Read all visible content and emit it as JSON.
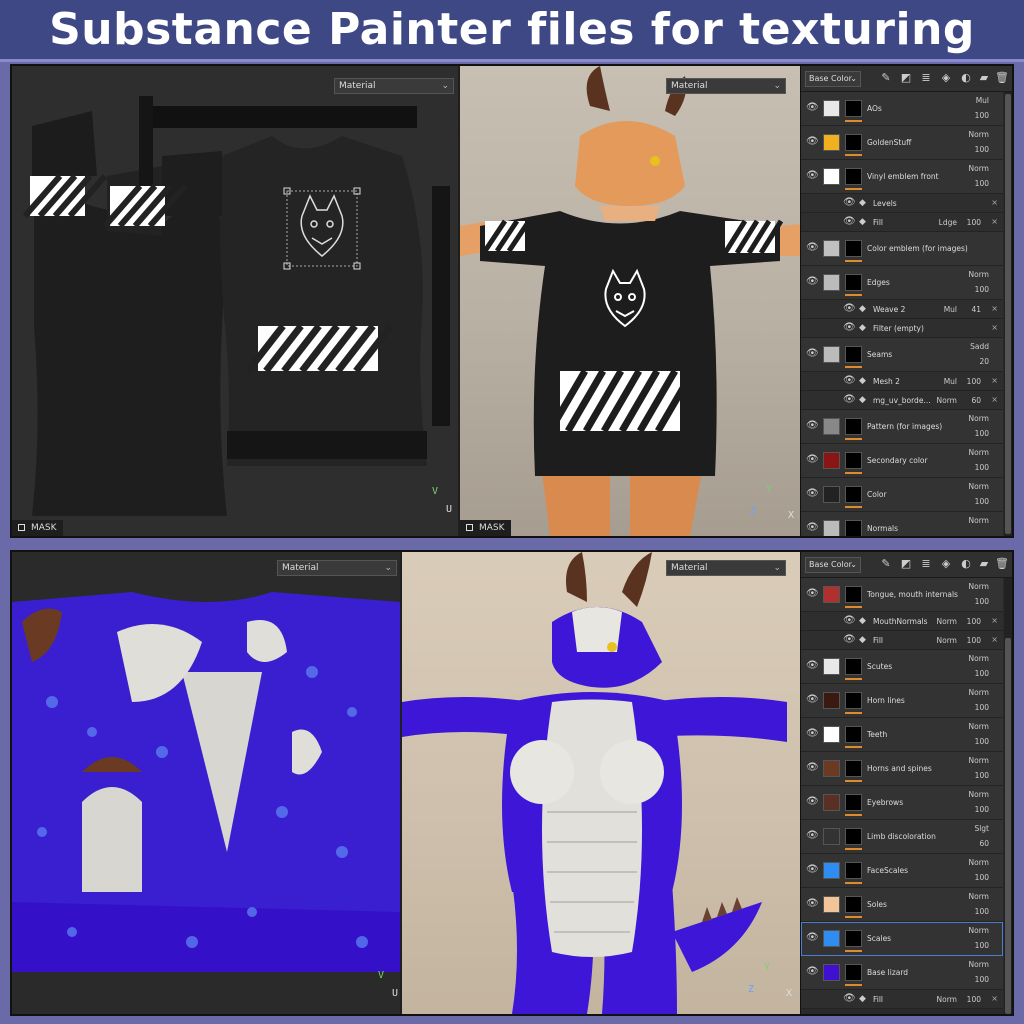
{
  "banner": {
    "title": "Substance Painter files for texturing"
  },
  "top": {
    "uv_dropdown": "Material",
    "view_dropdown": "Material",
    "mask_label": "MASK",
    "mask_label_3d": "MASK",
    "axis": {
      "u": "U",
      "v": "V",
      "x": "X",
      "y": "Y",
      "z": "Z"
    },
    "panel": {
      "channel": "Base Color",
      "layers": [
        {
          "name": "AOs",
          "blend": "Mul",
          "opacity": "100",
          "thumb": "#e8e8e8"
        },
        {
          "name": "GoldenStuff",
          "blend": "Norm",
          "opacity": "100",
          "thumb": "#f0b020"
        },
        {
          "name": "Vinyl emblem front",
          "blend": "Norm",
          "opacity": "100",
          "thumb": "#ffffff"
        },
        {
          "name": "Levels",
          "sub": true
        },
        {
          "name": "Fill",
          "sub": true,
          "blend": "Ldge",
          "opacity": "100"
        },
        {
          "name": "Color emblem (for images)",
          "blend": "",
          "opacity": "",
          "thumb": "#c0c0c0"
        },
        {
          "name": "Edges",
          "blend": "Norm",
          "opacity": "100",
          "thumb": "#bbbbbb"
        },
        {
          "name": "Weave 2",
          "sub": true,
          "blend": "Mul",
          "opacity": "41"
        },
        {
          "name": "Filter (empty)",
          "sub": true
        },
        {
          "name": "Seams",
          "blend": "Sadd",
          "opacity": "20",
          "thumb": "#bbbbbb"
        },
        {
          "name": "Mesh 2",
          "sub": true,
          "blend": "Mul",
          "opacity": "100"
        },
        {
          "name": "mg_uv_borde...",
          "sub": true,
          "blend": "Norm",
          "opacity": "60"
        },
        {
          "name": "Pattern (for images)",
          "blend": "Norm",
          "opacity": "100",
          "thumb": "#888888"
        },
        {
          "name": "Secondary color",
          "blend": "Norm",
          "opacity": "100",
          "thumb": "#8a1515"
        },
        {
          "name": "Color",
          "blend": "Norm",
          "opacity": "100",
          "thumb": "#222222"
        },
        {
          "name": "Normals",
          "blend": "Norm",
          "opacity": "",
          "thumb": "#bbbbbb"
        }
      ]
    }
  },
  "bottom": {
    "uv_dropdown": "Material",
    "view_dropdown": "Material",
    "axis": {
      "u": "U",
      "v": "V",
      "x": "X",
      "y": "Y",
      "z": "Z"
    },
    "panel": {
      "channel": "Base Color",
      "layers": [
        {
          "name": "Tongue, mouth internals",
          "blend": "Norm",
          "opacity": "100",
          "thumb": "#b03030"
        },
        {
          "name": "MouthNormals",
          "sub": true,
          "blend": "Norm",
          "opacity": "100"
        },
        {
          "name": "Fill",
          "sub": true,
          "blend": "Norm",
          "opacity": "100"
        },
        {
          "name": "Scutes",
          "blend": "Norm",
          "opacity": "100",
          "thumb": "#e8e8e8"
        },
        {
          "name": "Horn lines",
          "blend": "Norm",
          "opacity": "100",
          "thumb": "#3a1a10"
        },
        {
          "name": "Teeth",
          "blend": "Norm",
          "opacity": "100",
          "thumb": "#ffffff"
        },
        {
          "name": "Horns and spines",
          "blend": "Norm",
          "opacity": "100",
          "thumb": "#6a3a22"
        },
        {
          "name": "Eyebrows",
          "blend": "Norm",
          "opacity": "100",
          "thumb": "#5a3024"
        },
        {
          "name": "Limb discoloration",
          "blend": "Slgt",
          "opacity": "60",
          "thumb": "#333333"
        },
        {
          "name": "FaceScales",
          "blend": "Norm",
          "opacity": "100",
          "thumb": "#2f8cf0"
        },
        {
          "name": "Soles",
          "blend": "Norm",
          "opacity": "100",
          "thumb": "#f2c49a"
        },
        {
          "name": "Scales",
          "blend": "Norm",
          "opacity": "100",
          "thumb": "#2f8cf0",
          "selected": true
        },
        {
          "name": "Base lizard",
          "blend": "Norm",
          "opacity": "100",
          "thumb": "#4010d0"
        },
        {
          "name": "Fill",
          "sub": true,
          "blend": "Norm",
          "opacity": "100"
        }
      ]
    }
  }
}
